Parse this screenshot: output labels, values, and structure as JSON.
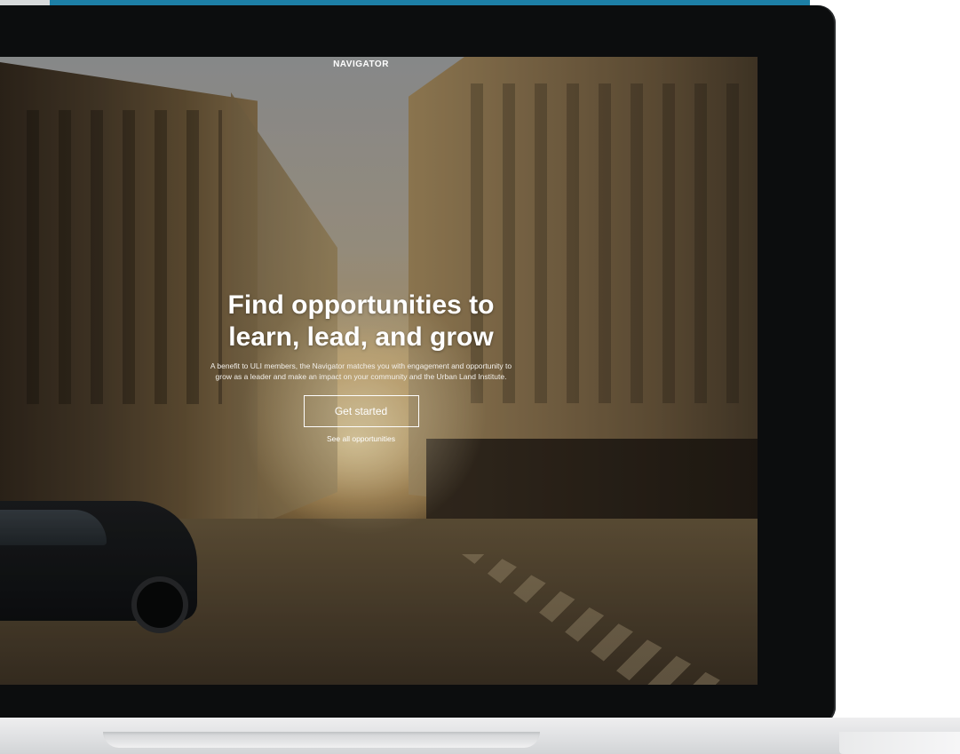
{
  "screen": {
    "brand": "NAVIGATOR",
    "hero": {
      "headline": "Find opportunities to learn, lead, and grow",
      "subtext": "A benefit to ULI members, the Navigator matches you with engagement and opportunity to grow as a leader and make an impact on your community and the Urban Land Institute.",
      "cta_label": "Get started",
      "secondary_link": "See all opportunities"
    }
  },
  "colors": {
    "accent_strip": "#1d7fa6",
    "text": "#ffffff",
    "bezel": "#0c0d0e"
  }
}
